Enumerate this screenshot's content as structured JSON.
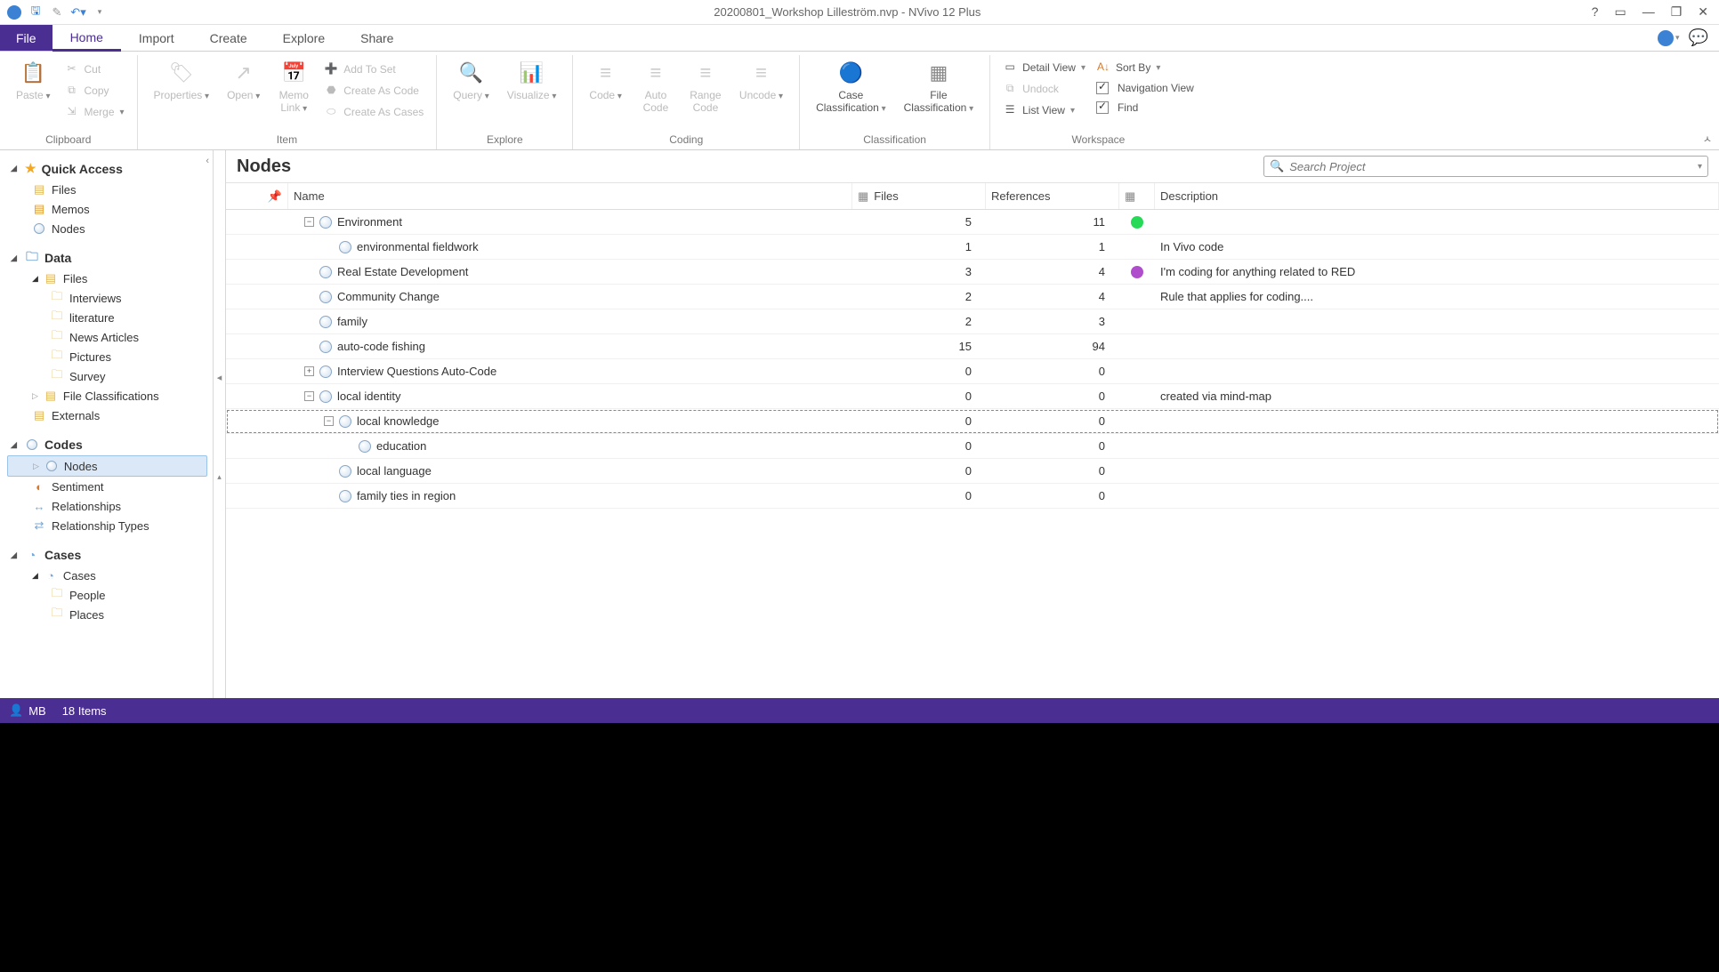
{
  "app": {
    "title": "20200801_Workshop Lilleström.nvp - NVivo 12 Plus"
  },
  "tabs": {
    "file": "File",
    "home": "Home",
    "import": "Import",
    "create": "Create",
    "explore": "Explore",
    "share": "Share"
  },
  "ribbon": {
    "clipboard": {
      "label": "Clipboard",
      "paste": "Paste",
      "cut": "Cut",
      "copy": "Copy",
      "merge": "Merge"
    },
    "item": {
      "label": "Item",
      "properties": "Properties",
      "open": "Open",
      "memo_link": "Memo\nLink",
      "add_to_set": "Add To Set",
      "create_as_code": "Create As Code",
      "create_as_cases": "Create As Cases"
    },
    "explore": {
      "label": "Explore",
      "query": "Query",
      "visualize": "Visualize"
    },
    "coding": {
      "label": "Coding",
      "code": "Code",
      "auto_code": "Auto\nCode",
      "range_code": "Range\nCode",
      "uncode": "Uncode"
    },
    "classification": {
      "label": "Classification",
      "case": "Case\nClassification",
      "file": "File\nClassification"
    },
    "workspace": {
      "label": "Workspace",
      "detail_view": "Detail View",
      "sort_by": "Sort By",
      "undock": "Undock",
      "navigation_view": "Navigation View",
      "list_view": "List View",
      "find": "Find"
    }
  },
  "nav": {
    "quick_access": {
      "label": "Quick Access",
      "files": "Files",
      "memos": "Memos",
      "nodes": "Nodes"
    },
    "data": {
      "label": "Data",
      "files": "Files",
      "interviews": "Interviews",
      "literature": "literature",
      "news": "News Articles",
      "pictures": "Pictures",
      "survey": "Survey",
      "file_class": "File Classifications",
      "externals": "Externals"
    },
    "codes": {
      "label": "Codes",
      "nodes": "Nodes",
      "sentiment": "Sentiment",
      "relationships": "Relationships",
      "rel_types": "Relationship Types"
    },
    "cases": {
      "label": "Cases",
      "cases": "Cases",
      "people": "People",
      "places": "Places"
    }
  },
  "list": {
    "title": "Nodes",
    "search_placeholder": "Search Project",
    "cols": {
      "name": "Name",
      "files": "Files",
      "refs": "References",
      "desc": "Description"
    },
    "rows": [
      {
        "indent": 0,
        "expander": "−",
        "name": "Environment",
        "files": "5",
        "refs": "11",
        "color": "#26d957",
        "desc": ""
      },
      {
        "indent": 1,
        "expander": "",
        "name": "environmental fieldwork",
        "files": "1",
        "refs": "1",
        "color": "",
        "desc": "In Vivo code"
      },
      {
        "indent": 0,
        "expander": "",
        "name": "Real Estate Development",
        "files": "3",
        "refs": "4",
        "color": "#b04dcd",
        "desc": "I'm coding for anything related to RED"
      },
      {
        "indent": 0,
        "expander": "",
        "name": "Community Change",
        "files": "2",
        "refs": "4",
        "color": "",
        "desc": "Rule that applies for coding...."
      },
      {
        "indent": 0,
        "expander": "",
        "name": "family",
        "files": "2",
        "refs": "3",
        "color": "",
        "desc": ""
      },
      {
        "indent": 0,
        "expander": "",
        "name": "auto-code fishing",
        "files": "15",
        "refs": "94",
        "color": "",
        "desc": ""
      },
      {
        "indent": 0,
        "expander": "+",
        "name": "Interview Questions Auto-Code",
        "files": "0",
        "refs": "0",
        "color": "",
        "desc": ""
      },
      {
        "indent": 0,
        "expander": "−",
        "name": "local identity",
        "files": "0",
        "refs": "0",
        "color": "",
        "desc": "created via  mind-map"
      },
      {
        "indent": 1,
        "expander": "−",
        "name": "local knowledge",
        "files": "0",
        "refs": "0",
        "color": "",
        "desc": "",
        "sel": true
      },
      {
        "indent": 2,
        "expander": "",
        "name": "education",
        "files": "0",
        "refs": "0",
        "color": "",
        "desc": ""
      },
      {
        "indent": 1,
        "expander": "",
        "name": "local language",
        "files": "0",
        "refs": "0",
        "color": "",
        "desc": ""
      },
      {
        "indent": 1,
        "expander": "",
        "name": "family ties in region",
        "files": "0",
        "refs": "0",
        "color": "",
        "desc": ""
      }
    ]
  },
  "status": {
    "user": "MB",
    "items": "18 Items"
  }
}
